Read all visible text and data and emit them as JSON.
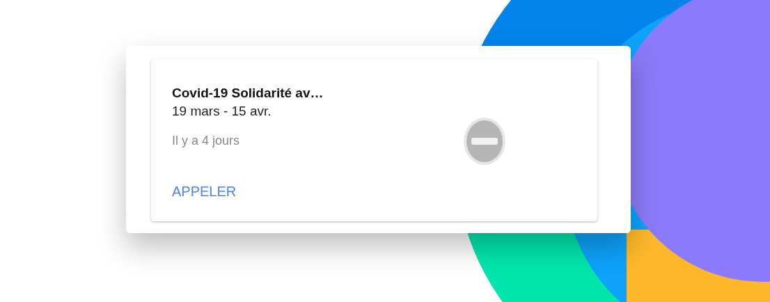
{
  "card": {
    "title": "Covid-19 Solidarité av…",
    "dates": "19 mars - 15 avr.",
    "time_ago": "Il y a 4 jours",
    "action": "APPELER"
  }
}
